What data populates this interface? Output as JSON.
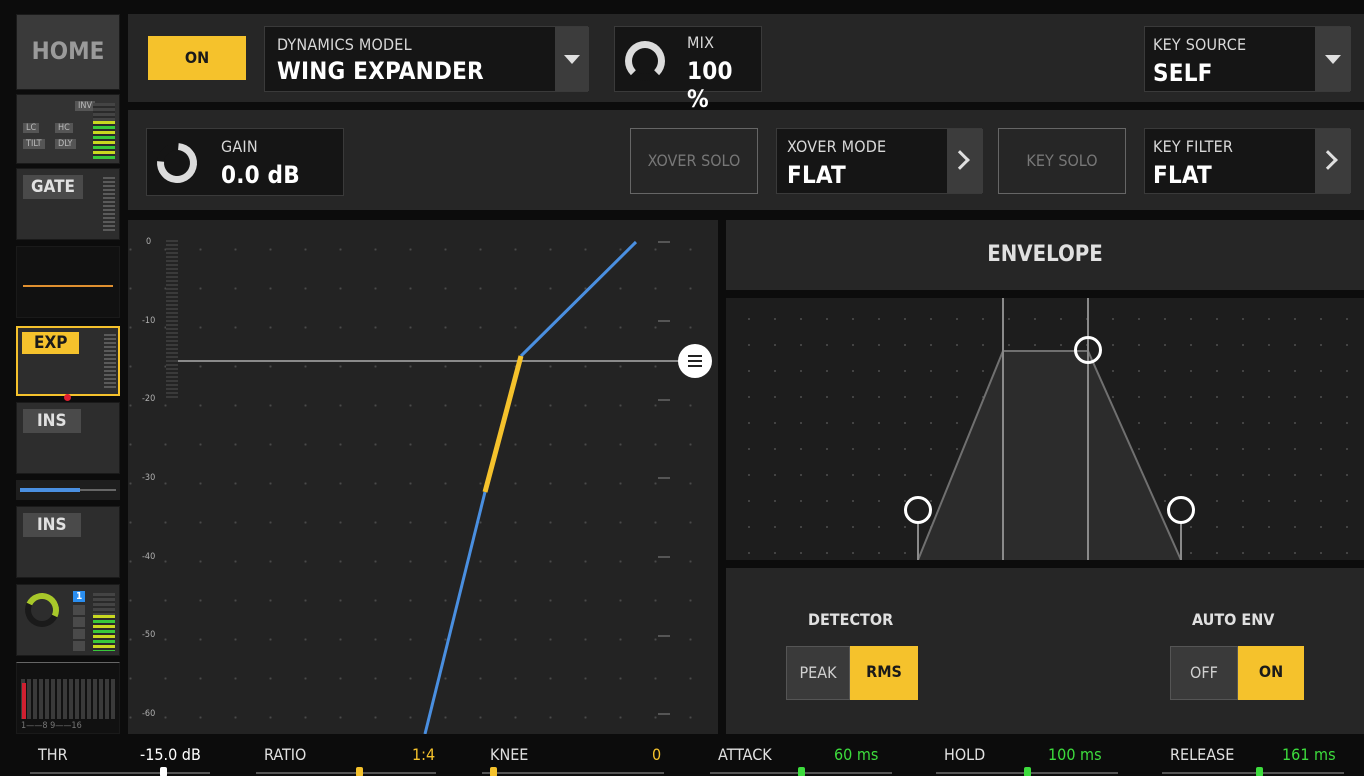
{
  "sidebar": {
    "home_label": "HOME",
    "filter_tags": [
      "INV",
      "LC",
      "HC",
      "TILT",
      "DLY"
    ],
    "gate_label": "GATE",
    "exp_label": "EXP",
    "ins1_label": "INS",
    "ins2_label": "INS",
    "bus_badge": "1",
    "meter_scale": "1——8  9——16"
  },
  "header": {
    "on_label": "ON",
    "model_caption": "DYNAMICS MODEL",
    "model_value": "WING EXPANDER",
    "mix_caption": "MIX",
    "mix_value": "100 %",
    "key_source_caption": "KEY SOURCE",
    "key_source_value": "SELF"
  },
  "row2": {
    "gain_caption": "GAIN",
    "gain_value": "0.0 dB",
    "xover_solo_label": "XOVER SOLO",
    "xover_mode_caption": "XOVER MODE",
    "xover_mode_value": "FLAT",
    "key_solo_label": "KEY SOLO",
    "key_filter_caption": "KEY FILTER",
    "key_filter_value": "FLAT"
  },
  "graph": {
    "y_labels": [
      "0",
      "-10",
      "-20",
      "-30",
      "-40",
      "-50",
      "-60"
    ]
  },
  "envelope": {
    "title": "ENVELOPE"
  },
  "detector": {
    "caption": "DETECTOR",
    "options": [
      "PEAK",
      "RMS"
    ],
    "selected": "RMS"
  },
  "auto_env": {
    "caption": "AUTO ENV",
    "options": [
      "OFF",
      "ON"
    ],
    "selected": "ON"
  },
  "params": [
    {
      "label": "THR",
      "value": "-15.0 dB",
      "color": "#ffffff"
    },
    {
      "label": "RATIO",
      "value": "1:4",
      "color": "#f5c22c"
    },
    {
      "label": "KNEE",
      "value": "0",
      "color": "#f5c22c"
    },
    {
      "label": "ATTACK",
      "value": "60 ms",
      "color": "#3ddc3d"
    },
    {
      "label": "HOLD",
      "value": "100 ms",
      "color": "#3ddc3d"
    },
    {
      "label": "RELEASE",
      "value": "161 ms",
      "color": "#3ddc3d"
    }
  ],
  "colors": {
    "accent": "#f5c22c",
    "curve": "#4a8fe0",
    "green": "#3ddc3d"
  }
}
